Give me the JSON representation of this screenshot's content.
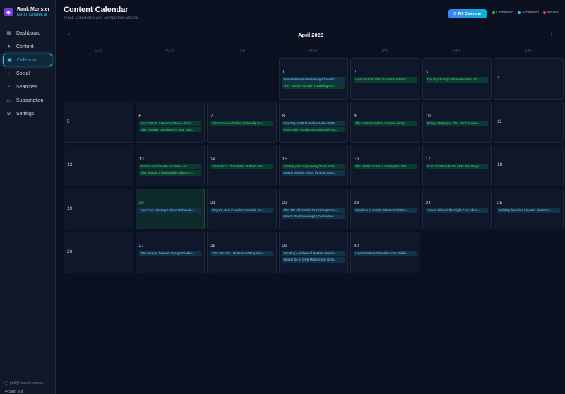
{
  "brand": {
    "name": "Rank Monster",
    "url": "rankmonster.ai"
  },
  "nav": [
    {
      "label": "Dashboard",
      "icon": "grid-icon",
      "glyph": "▦",
      "active": false
    },
    {
      "label": "Content",
      "icon": "sparkle-icon",
      "glyph": "✦",
      "active": false
    },
    {
      "label": "Calendar",
      "icon": "calendar-icon",
      "glyph": "▣",
      "active": true
    },
    {
      "label": "Social",
      "icon": "chat-icon",
      "glyph": "◌",
      "active": false
    },
    {
      "label": "Searches",
      "icon": "search-icon",
      "glyph": "⌕",
      "active": false
    },
    {
      "label": "Subscription",
      "icon": "card-icon",
      "glyph": "▭",
      "active": false
    },
    {
      "label": "Settings",
      "icon": "gear-icon",
      "glyph": "⚙",
      "active": false
    }
  ],
  "user": {
    "email": "phil@foundersmas...",
    "signout": "Sign out"
  },
  "header": {
    "title": "Content Calendar",
    "subtitle": "Track scheduled and completed actions",
    "fill_button": "Fill Calendar"
  },
  "legend": [
    {
      "label": "Completed",
      "color": "#22c55e"
    },
    {
      "label": "Scheduled",
      "color": "#38bdf8"
    },
    {
      "label": "Missed",
      "color": "#ef4444"
    }
  ],
  "month": {
    "label": "April 2026",
    "prev": "‹",
    "next": "›"
  },
  "weekdays": [
    "SUN",
    "MON",
    "TUE",
    "WED",
    "THU",
    "FRI",
    "SAT"
  ],
  "leading_blanks": 3,
  "days": [
    {
      "day": "1",
      "items": [
        {
          "t": "How Elite Founders Manage Their En...",
          "s": "scheduled"
        },
        {
          "t": "The Founder's Guide to Building Acc...",
          "s": "completed"
        }
      ]
    },
    {
      "day": "2",
      "items": [
        {
          "t": "Lessons from 100 Founder Mastermi...",
          "s": "completed"
        }
      ]
    },
    {
      "day": "3",
      "items": [
        {
          "t": "The Psychology of Effective Peer Ad...",
          "s": "completed"
        }
      ]
    },
    {
      "day": "4",
      "items": []
    },
    {
      "day": "5",
      "items": []
    },
    {
      "day": "6",
      "items": [
        {
          "t": "How to Build a Personal Board of Ad...",
          "s": "completed"
        },
        {
          "t": "Why Founder Loneliness Is Your Star...",
          "s": "completed"
        }
      ]
    },
    {
      "day": "7",
      "items": [
        {
          "t": "The Compound Effect of Weekly Fou...",
          "s": "completed"
        }
      ]
    },
    {
      "day": "8",
      "items": [
        {
          "t": "How Top SaaS Founders Make Better...",
          "s": "scheduled"
        },
        {
          "t": "From Solo Founder to Supported Fou...",
          "s": "completed"
        }
      ]
    },
    {
      "day": "9",
      "items": [
        {
          "t": "The SaaS Founder's Guide to Hiring...",
          "s": "completed"
        }
      ]
    },
    {
      "day": "10",
      "items": [
        {
          "t": "Pricing Strategies That 10x'd Revenu...",
          "s": "completed"
        }
      ]
    },
    {
      "day": "11",
      "items": []
    },
    {
      "day": "12",
      "items": []
    },
    {
      "day": "13",
      "items": [
        {
          "t": "Product-Led Growth vs Sales-Led: ...",
          "s": "completed"
        },
        {
          "t": "How to Build a Repeatable Sales Pro...",
          "s": "completed"
        }
      ]
    },
    {
      "day": "14",
      "items": [
        {
          "t": "The Metrics That Matter at Each Saa...",
          "s": "completed"
        }
      ]
    },
    {
      "day": "15",
      "items": [
        {
          "t": "Scaling Your Engineering Team: A Fo...",
          "s": "completed"
        },
        {
          "t": "How to Reduce Churn by 40%: Less...",
          "s": "scheduled"
        }
      ]
    },
    {
      "day": "16",
      "items": [
        {
          "t": "The Hidden Costs of Scaling Too Fas...",
          "s": "completed"
        }
      ]
    },
    {
      "day": "17",
      "items": [
        {
          "t": "From $100K to $10M ARR: The Playb...",
          "s": "completed"
        }
      ]
    },
    {
      "day": "18",
      "items": []
    },
    {
      "day": "19",
      "items": []
    },
    {
      "day": "20",
      "today": true,
      "items": [
        {
          "t": "How Peer Advisory Helped 50 Found...",
          "s": "scheduled"
        }
      ]
    },
    {
      "day": "21",
      "items": [
        {
          "t": "Why the Best Founders Invest in Co...",
          "s": "scheduled"
        }
      ]
    },
    {
      "day": "22",
      "items": [
        {
          "t": "The ROI of Founder Peer Groups: Re...",
          "s": "scheduled"
        },
        {
          "t": "How to Build Meaningful Connection...",
          "s": "scheduled"
        }
      ]
    },
    {
      "day": "23",
      "items": [
        {
          "t": "Virtual vs In-Person Mastermind Gro...",
          "s": "scheduled"
        }
      ]
    },
    {
      "day": "24",
      "items": [
        {
          "t": "How to Choose the Right Peer Advis...",
          "s": "scheduled"
        }
      ]
    },
    {
      "day": "25",
      "items": [
        {
          "t": "Building Trust in a Founder Masterm...",
          "s": "scheduled"
        }
      ]
    },
    {
      "day": "26",
      "items": []
    },
    {
      "day": "27",
      "items": [
        {
          "t": "Why Diverse Founder Groups Produc...",
          "s": "scheduled"
        }
      ]
    },
    {
      "day": "28",
      "items": [
        {
          "t": "The Art of the Hot Seat: Getting Max...",
          "s": "scheduled"
        }
      ]
    },
    {
      "day": "29",
      "items": [
        {
          "t": "Creating a Culture of Radical Candor...",
          "s": "scheduled"
        },
        {
          "t": "How to Be a Great Mastermind Grou...",
          "s": "scheduled"
        }
      ]
    },
    {
      "day": "30",
      "items": [
        {
          "t": "How Founders Transition from Builde...",
          "s": "scheduled"
        }
      ]
    }
  ]
}
